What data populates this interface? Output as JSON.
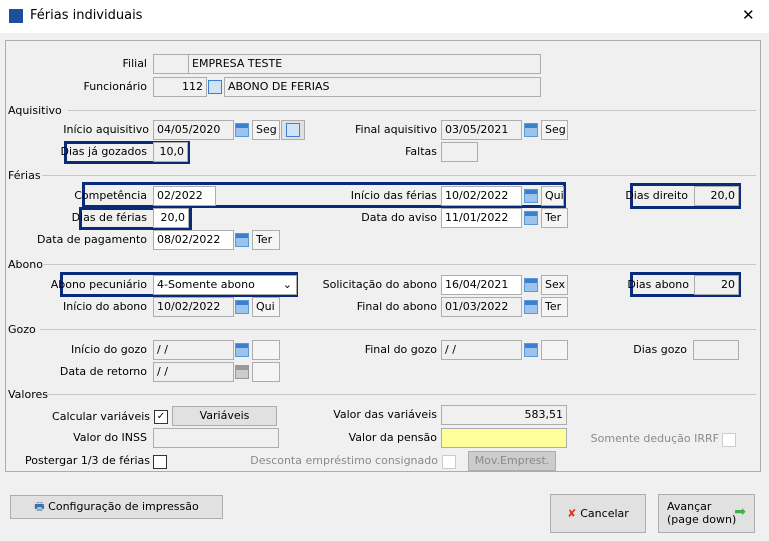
{
  "window": {
    "title": "Férias individuais",
    "close": "✕"
  },
  "filial": {
    "label": "Filial",
    "code": "",
    "name": "EMPRESA TESTE"
  },
  "funcionario": {
    "label": "Funcionário",
    "code": "112",
    "name": "ABONO DE FERIAS"
  },
  "aquisitivo": {
    "section": "Aquisitivo",
    "inicio_label": "Início aquisitivo",
    "inicio": "04/05/2020",
    "inicio_day": "Seg",
    "final_label": "Final aquisitivo",
    "final": "03/05/2021",
    "final_day": "Seg",
    "dias_gozados_label": "Dias já gozados",
    "dias_gozados": "10,0",
    "faltas_label": "Faltas",
    "faltas": ""
  },
  "ferias": {
    "section": "Férias",
    "competencia_label": "Competência",
    "competencia": "02/2022",
    "inicio_label": "Início das férias",
    "inicio": "10/02/2022",
    "inicio_day": "Qui",
    "dias_direito_label": "Dias direito",
    "dias_direito": "20,0",
    "dias_ferias_label": "Dias de férias",
    "dias_ferias": "20,0",
    "aviso_label": "Data do aviso",
    "aviso": "11/01/2022",
    "aviso_day": "Ter",
    "pagamento_label": "Data de pagamento",
    "pagamento": "08/02/2022",
    "pagamento_day": "Ter"
  },
  "abono": {
    "section": "Abono",
    "pecuniario_label": "Abono pecuniário",
    "pecuniario": "4-Somente abono",
    "solicitacao_label": "Solicitação do abono",
    "solicitacao": "16/04/2021",
    "solicitacao_day": "Sex",
    "dias_label": "Dias abono",
    "dias": "20",
    "inicio_label": "Início do abono",
    "inicio": "10/02/2022",
    "inicio_day": "Qui",
    "final_label": "Final do abono",
    "final": "01/03/2022",
    "final_day": "Ter"
  },
  "gozo": {
    "section": "Gozo",
    "inicio_label": "Início do gozo",
    "inicio": " / /",
    "final_label": "Final do gozo",
    "final": " / /",
    "dias_label": "Dias gozo",
    "retorno_label": "Data de retorno",
    "retorno": " / /"
  },
  "valores": {
    "section": "Valores",
    "calcular_label": "Calcular variáveis",
    "calcular_checked": true,
    "variaveis_button": "Variáveis",
    "valor_variaveis_label": "Valor das variáveis",
    "valor_variaveis": "583,51",
    "inss_label": "Valor do INSS",
    "inss": "",
    "pensao_label": "Valor da pensão",
    "pensao": "",
    "irrf_label": "Somente dedução IRRF",
    "postergar_label": "Postergar 1/3 de férias",
    "consignado_label": "Desconta empréstimo consignado",
    "mov_button": "Mov.Emprest."
  },
  "footer": {
    "config_button": "Configuração de impressão",
    "cancel_button": "Cancelar",
    "next_button_line1": "Avançar",
    "next_button_line2": "(page down)"
  },
  "colors": {
    "highlight": "#0a2a7a",
    "pensao_bg": "#ffff99"
  }
}
